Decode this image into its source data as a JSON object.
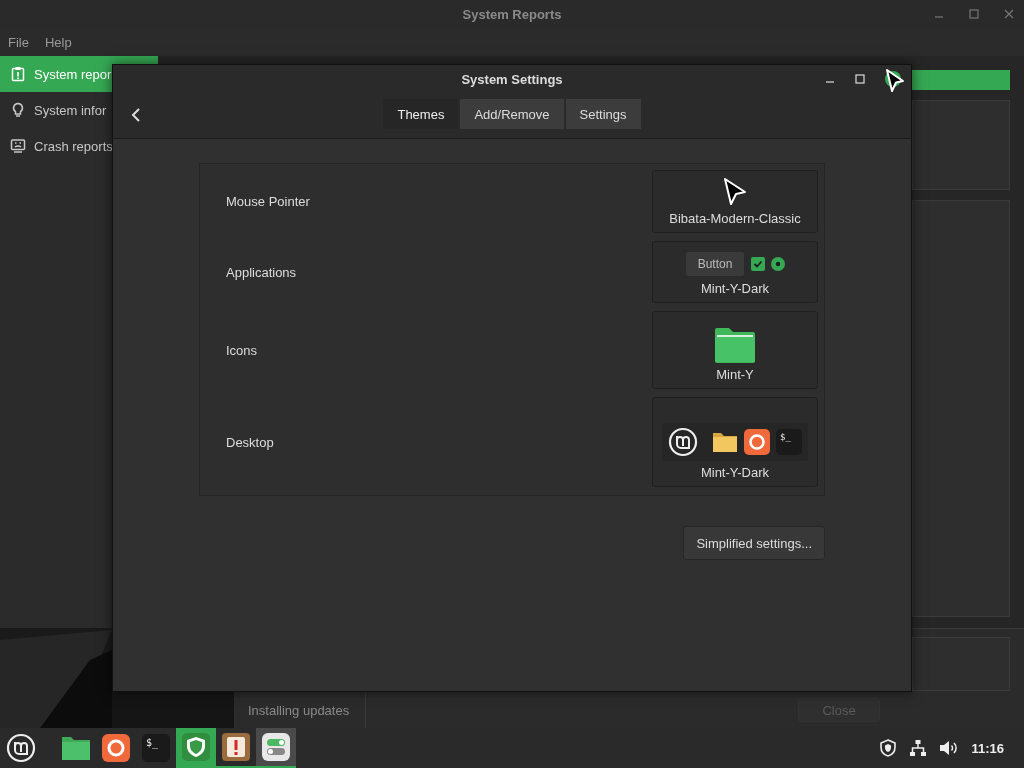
{
  "reports_window": {
    "title": "System Reports",
    "menu": [
      "File",
      "Help"
    ],
    "sidebar": [
      {
        "label": "System repor",
        "selected": true
      },
      {
        "label": "System infor",
        "selected": false
      },
      {
        "label": "Crash reports",
        "selected": false
      }
    ]
  },
  "update_window": {
    "status": "Installing updates",
    "close_button": {
      "label": "Close",
      "disabled": true
    }
  },
  "settings_window": {
    "title": "System Settings",
    "tabs": [
      {
        "label": "Themes",
        "selected": true
      },
      {
        "label": "Add/Remove",
        "selected": false
      },
      {
        "label": "Settings",
        "selected": false
      }
    ],
    "rows": [
      {
        "label": "Mouse Pointer",
        "preview": {
          "kind": "pointer",
          "name": "Bibata-Modern-Classic"
        }
      },
      {
        "label": "Applications",
        "preview": {
          "kind": "widgets",
          "name": "Mint-Y-Dark",
          "button": "Button",
          "checked": true,
          "radio_selected": true
        }
      },
      {
        "label": "Icons",
        "preview": {
          "kind": "folder",
          "name": "Mint-Y"
        }
      },
      {
        "label": "Desktop",
        "preview": {
          "kind": "panel",
          "name": "Mint-Y-Dark",
          "terminal_prompt": "$_"
        }
      }
    ],
    "simplified_button": "Simplified settings..."
  },
  "taskbar": {
    "apps": [
      {
        "kind": "files",
        "running": false,
        "selected": false,
        "urgent": false
      },
      {
        "kind": "firefox",
        "running": false,
        "selected": false,
        "urgent": false
      },
      {
        "kind": "terminal",
        "running": false,
        "selected": false,
        "urgent": false,
        "prompt": "$_"
      },
      {
        "kind": "shield",
        "running": true,
        "selected": false,
        "urgent": true
      },
      {
        "kind": "reports",
        "running": true,
        "selected": false,
        "urgent": false
      },
      {
        "kind": "settings",
        "running": true,
        "selected": true,
        "urgent": false
      }
    ],
    "clock": "11:16"
  }
}
